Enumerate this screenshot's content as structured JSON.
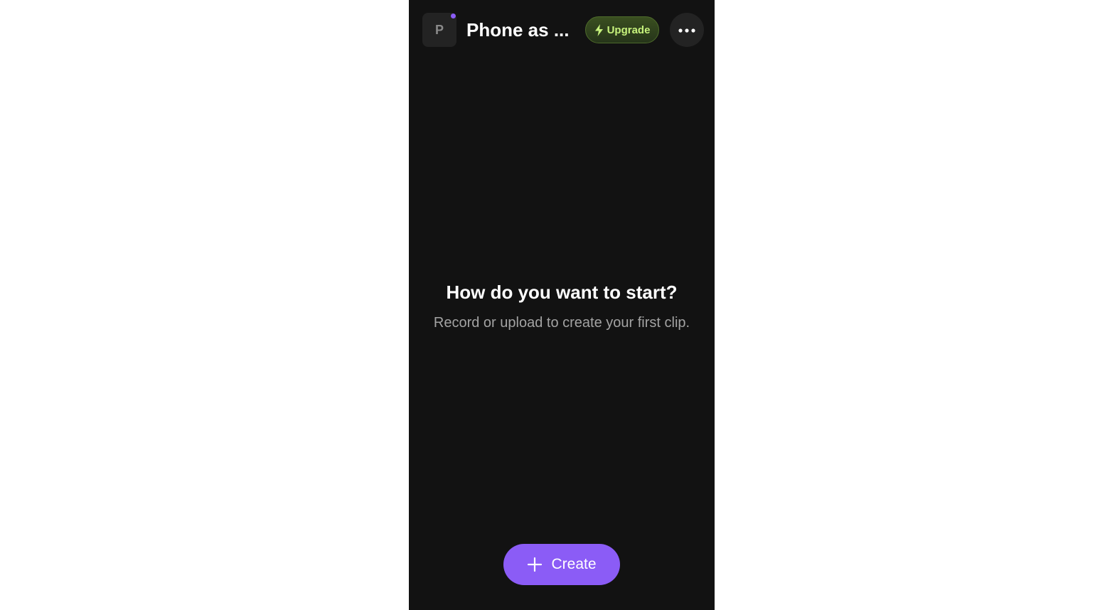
{
  "header": {
    "avatar_letter": "P",
    "title": "Phone as ...",
    "upgrade_label": "Upgrade",
    "upgrade_icon": "lightning-bolt-icon",
    "more_icon": "more-horizontal-icon"
  },
  "empty_state": {
    "heading": "How do you want to start?",
    "subtext": "Record or upload to create your first clip."
  },
  "create_button": {
    "label": "Create",
    "icon": "plus-icon"
  },
  "colors": {
    "background": "#121212",
    "accent": "#8b5cf6",
    "upgrade_text": "#c6f27c",
    "upgrade_bg": "#2f4220"
  }
}
